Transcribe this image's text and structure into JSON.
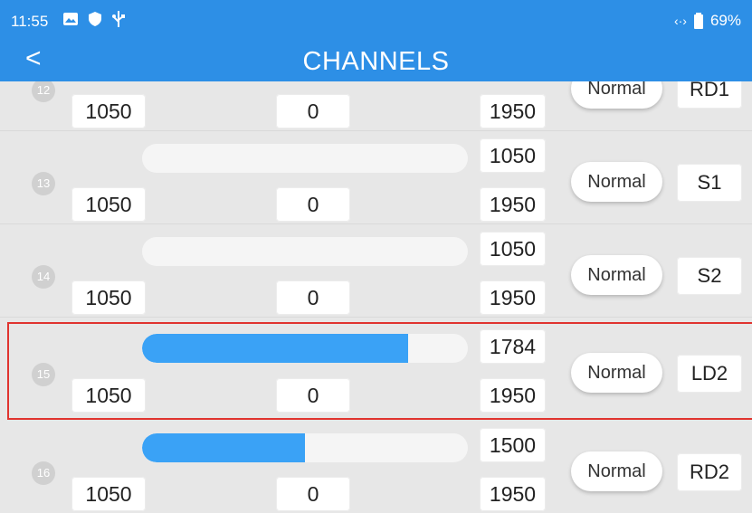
{
  "status": {
    "time": "11:55",
    "battery": "69%",
    "link_icon": "‹·›"
  },
  "header": {
    "back": "<",
    "title": "CHANNELS"
  },
  "rows": [
    {
      "num": "12",
      "min": "1050",
      "center": "0",
      "top": "",
      "max": "1950",
      "mode": "Normal",
      "label": "RD1",
      "value": null,
      "fill_fraction": 0
    },
    {
      "num": "13",
      "min": "1050",
      "center": "0",
      "top": "1050",
      "max": "1950",
      "mode": "Normal",
      "label": "S1",
      "value": "1050",
      "fill_fraction": 0
    },
    {
      "num": "14",
      "min": "1050",
      "center": "0",
      "top": "1050",
      "max": "1950",
      "mode": "Normal",
      "label": "S2",
      "value": "1050",
      "fill_fraction": 0
    },
    {
      "num": "15",
      "min": "1050",
      "center": "0",
      "top": "1784",
      "max": "1950",
      "mode": "Normal",
      "label": "LD2",
      "value": "1784",
      "fill_fraction": 0.8156
    },
    {
      "num": "16",
      "min": "1050",
      "center": "0",
      "top": "1500",
      "max": "1950",
      "mode": "Normal",
      "label": "RD2",
      "value": "1500",
      "fill_fraction": 0.5
    }
  ],
  "colors": {
    "accent": "#2d8fe6",
    "fill": "#3aa2f6",
    "selected_border": "#e0342f"
  }
}
